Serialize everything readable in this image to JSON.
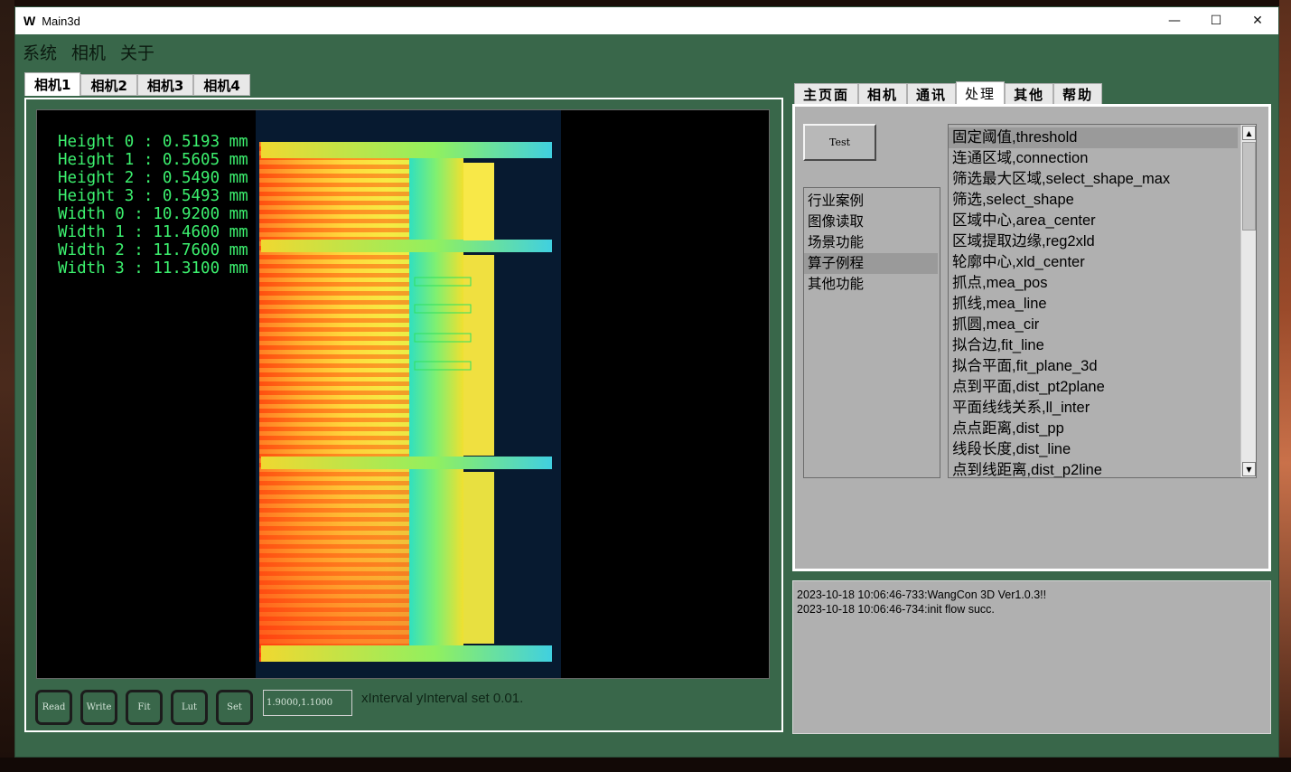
{
  "window": {
    "logo": "W",
    "title": "Main3d",
    "minimize": "—",
    "maximize": "☐",
    "close": "✕"
  },
  "menu": [
    "系统",
    "相机",
    "关于"
  ],
  "camera_tabs": [
    "相机1",
    "相机2",
    "相机3",
    "相机4"
  ],
  "active_camera_tab": "相机1",
  "measurements": [
    "Height 0 : 0.5193 mm",
    "Height 1 : 0.5605 mm",
    "Height 2 : 0.5490 mm",
    "Height 3 : 0.5493 mm",
    "Width 0 : 10.9200 mm",
    "Width 1 : 11.4600 mm",
    "Width 2 : 11.7600 mm",
    "Width 3 : 11.3100 mm"
  ],
  "buttons": {
    "read": "Read",
    "write": "Write",
    "fit": "Fit",
    "lut": "Lut",
    "set": "Set"
  },
  "coords": "1.9000,1.1000",
  "status": "xInterval yInterval set 0.01.",
  "right_tabs": [
    "主页面",
    "相机",
    "通讯",
    "处理",
    "其他",
    "帮助"
  ],
  "active_right_tab": "处理",
  "test_button": "Test",
  "categories": [
    "行业案例",
    "图像读取",
    "场景功能",
    "算子例程",
    "其他功能"
  ],
  "selected_category": "算子例程",
  "operators": [
    "固定阈值,threshold",
    "连通区域,connection",
    "筛选最大区域,select_shape_max",
    "筛选,select_shape",
    "区域中心,area_center",
    "区域提取边缘,reg2xld",
    "轮廓中心,xld_center",
    "抓点,mea_pos",
    "抓线,mea_line",
    "抓圆,mea_cir",
    "拟合边,fit_line",
    "拟合平面,fit_plane_3d",
    "点到平面,dist_pt2plane",
    "平面线线关系,ll_inter",
    "点点距离,dist_pp",
    "线段长度,dist_line",
    "点到线距离,dist_p2line"
  ],
  "selected_operator": "固定阈值,threshold",
  "log": [
    "2023-10-18 10:06:46-733:WangCon 3D Ver1.0.3!!",
    "2023-10-18 10:06:46-734:init flow succ."
  ],
  "colors": {
    "window_bg": "#39674a",
    "panel_gray": "#b0b0b0",
    "measure_text": "#3cf06e",
    "scan_bg": "#071a30"
  }
}
